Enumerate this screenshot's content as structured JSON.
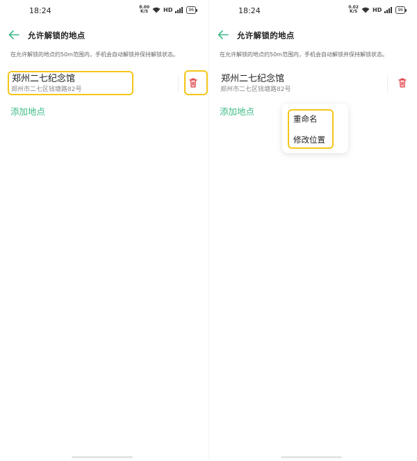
{
  "status_bar": {
    "time": "18:24",
    "speed_left": [
      "8.00",
      "K/S"
    ],
    "speed_right": [
      "0.02",
      "K/S"
    ],
    "network": "HD",
    "battery": "96"
  },
  "header": {
    "back_icon": "arrow-left-icon",
    "title": "允许解锁的地点"
  },
  "description": "在允许解锁的地点约50m范围内，手机会自动解锁并保持解锁状态。",
  "location": {
    "name": "郑州二七纪念馆",
    "address": "郑州市二七区钱塘路82号",
    "delete_icon": "trash-icon"
  },
  "add_location": "添加地点",
  "context_menu": {
    "items": [
      "重命名",
      "修改位置"
    ]
  },
  "colors": {
    "accent": "#3dba86",
    "delete": "#e0484f",
    "highlight": "#f5c518"
  }
}
